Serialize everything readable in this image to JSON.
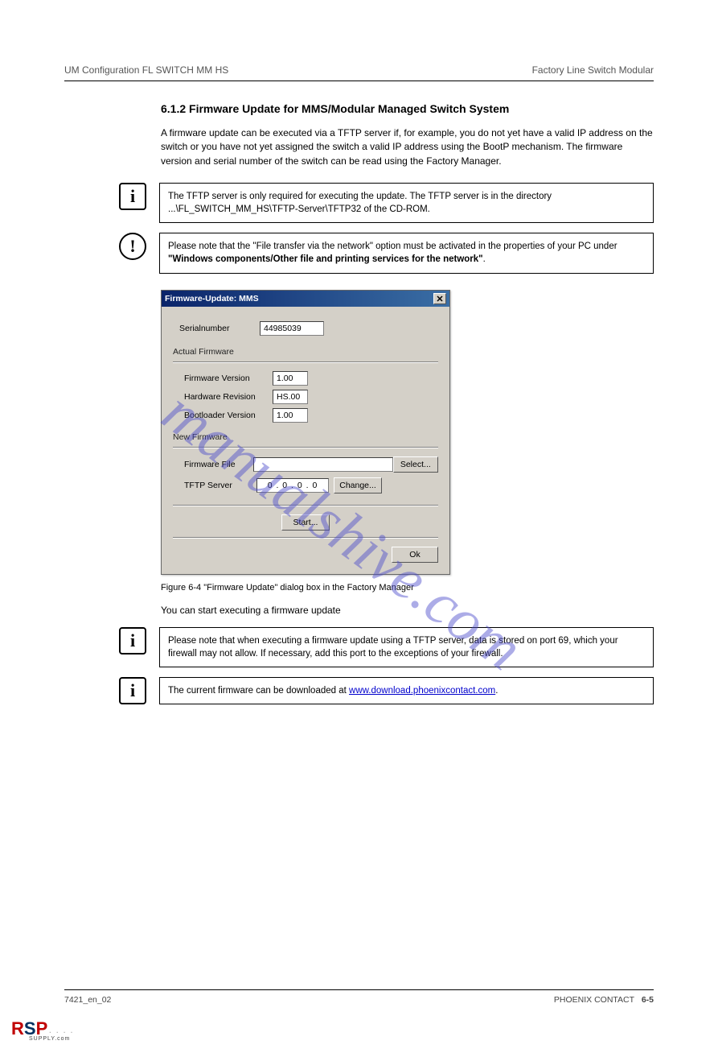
{
  "header": {
    "section": "UM Configuration FL SWITCH MM HS",
    "pageTopRight": "Factory Line Switch Modular"
  },
  "chapter": {
    "title": "6.1.2 Firmware Update for MMS/Modular Managed Switch System",
    "intro": "A firmware update can be executed via a TFTP server if, for example, you do not yet have a valid IP address on the switch or you have not yet assigned the switch a valid IP address using the BootP mechanism. The firmware version and serial number of the switch can be read using the Factory Manager.",
    "note1": "The TFTP server is only required for executing the update. The TFTP server is in the directory ...\\FL_SWITCH_MM_HS\\TFTP-Server\\TFTP32 of the CD-ROM.",
    "note2_prefix": "Please note that the \"File transfer via the network\" option must be activated in the properties of your PC under ",
    "note2_bold": "\"Windows components/Other file and printing services for the network\"",
    "note2_suffix": "."
  },
  "dialog": {
    "title": "Firmware-Update: MMS",
    "serial_label": "Serialnumber",
    "serial_value": "44985039",
    "group_actual": "Actual Firmware",
    "fw_version_label": "Firmware Version",
    "fw_version_value": "1.00",
    "hw_rev_label": "Hardware Revision",
    "hw_rev_value": "HS.00",
    "boot_label": "Bootloader Version",
    "boot_value": "1.00",
    "group_new": "New Firmware",
    "file_label": "Firmware File",
    "file_value": "",
    "select_btn": "Select...",
    "tftp_label": "TFTP Server",
    "tftp_value": "0 . 0 . 0 . 0",
    "change_btn": "Change...",
    "start_btn": "Start...",
    "ok_btn": "Ok"
  },
  "figure": {
    "caption": "Figure 6-4    \"Firmware Update\" dialog box in the Factory Manager"
  },
  "afterFigure": "You can start executing a firmware update",
  "note3": "Please note that when executing a firmware update using a TFTP server, data is stored on port 69, which your firewall may not allow. If necessary, add this port to the exceptions of your firewall.",
  "note4": {
    "text": "The current firmware can be downloaded at ",
    "link_label": "www.download.phoenixcontact.com",
    "link_href": "http://www.download.phoenixcontact.com",
    "suffix": "."
  },
  "footer": {
    "doc": "7421_en_02",
    "company": "PHOENIX CONTACT",
    "page": "6-5"
  },
  "watermark": "manualshive.com",
  "icons": {
    "info": "i",
    "caution": "!"
  }
}
